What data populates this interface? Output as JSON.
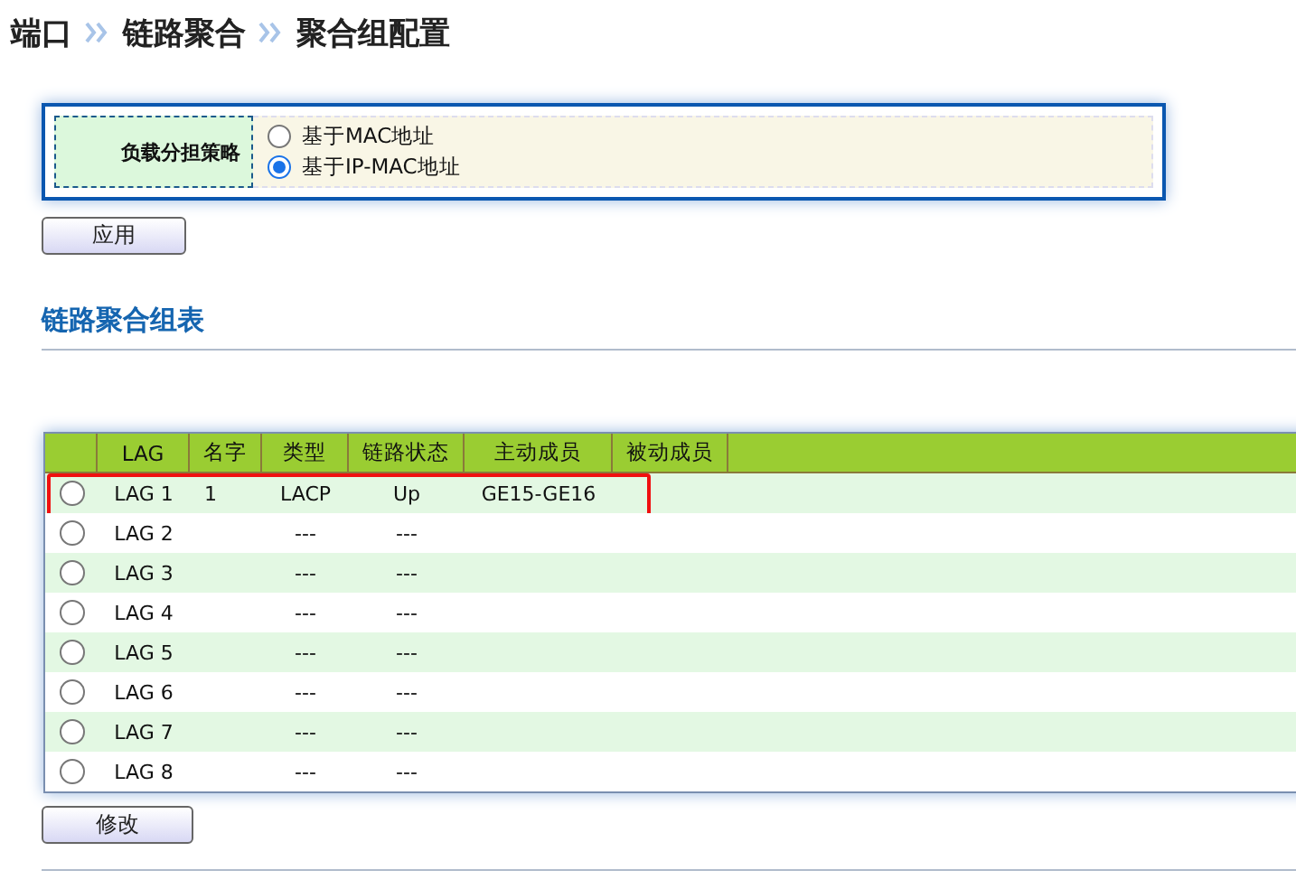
{
  "breadcrumb": [
    "端口",
    "链路聚合",
    "聚合组配置"
  ],
  "load_balance": {
    "label": "负载分担策略",
    "options": [
      {
        "label": "基于MAC地址",
        "selected": false
      },
      {
        "label": "基于IP-MAC地址",
        "selected": true
      }
    ]
  },
  "apply_button": "应用",
  "section_title": "链路聚合组表",
  "table": {
    "columns": [
      "LAG",
      "名字",
      "类型",
      "链路状态",
      "主动成员",
      "被动成员"
    ],
    "rows": [
      {
        "selected": false,
        "highlighted": true,
        "cells": [
          "LAG 1",
          "1",
          "LACP",
          "Up",
          "GE15-GE16",
          ""
        ]
      },
      {
        "selected": false,
        "highlighted": false,
        "cells": [
          "LAG 2",
          "",
          "---",
          "---",
          "",
          ""
        ]
      },
      {
        "selected": false,
        "highlighted": false,
        "cells": [
          "LAG 3",
          "",
          "---",
          "---",
          "",
          ""
        ]
      },
      {
        "selected": false,
        "highlighted": false,
        "cells": [
          "LAG 4",
          "",
          "---",
          "---",
          "",
          ""
        ]
      },
      {
        "selected": false,
        "highlighted": false,
        "cells": [
          "LAG 5",
          "",
          "---",
          "---",
          "",
          ""
        ]
      },
      {
        "selected": false,
        "highlighted": false,
        "cells": [
          "LAG 6",
          "",
          "---",
          "---",
          "",
          ""
        ]
      },
      {
        "selected": false,
        "highlighted": false,
        "cells": [
          "LAG 7",
          "",
          "---",
          "---",
          "",
          ""
        ]
      },
      {
        "selected": false,
        "highlighted": false,
        "cells": [
          "LAG 8",
          "",
          "---",
          "---",
          "",
          ""
        ]
      }
    ]
  },
  "modify_button": "修改"
}
